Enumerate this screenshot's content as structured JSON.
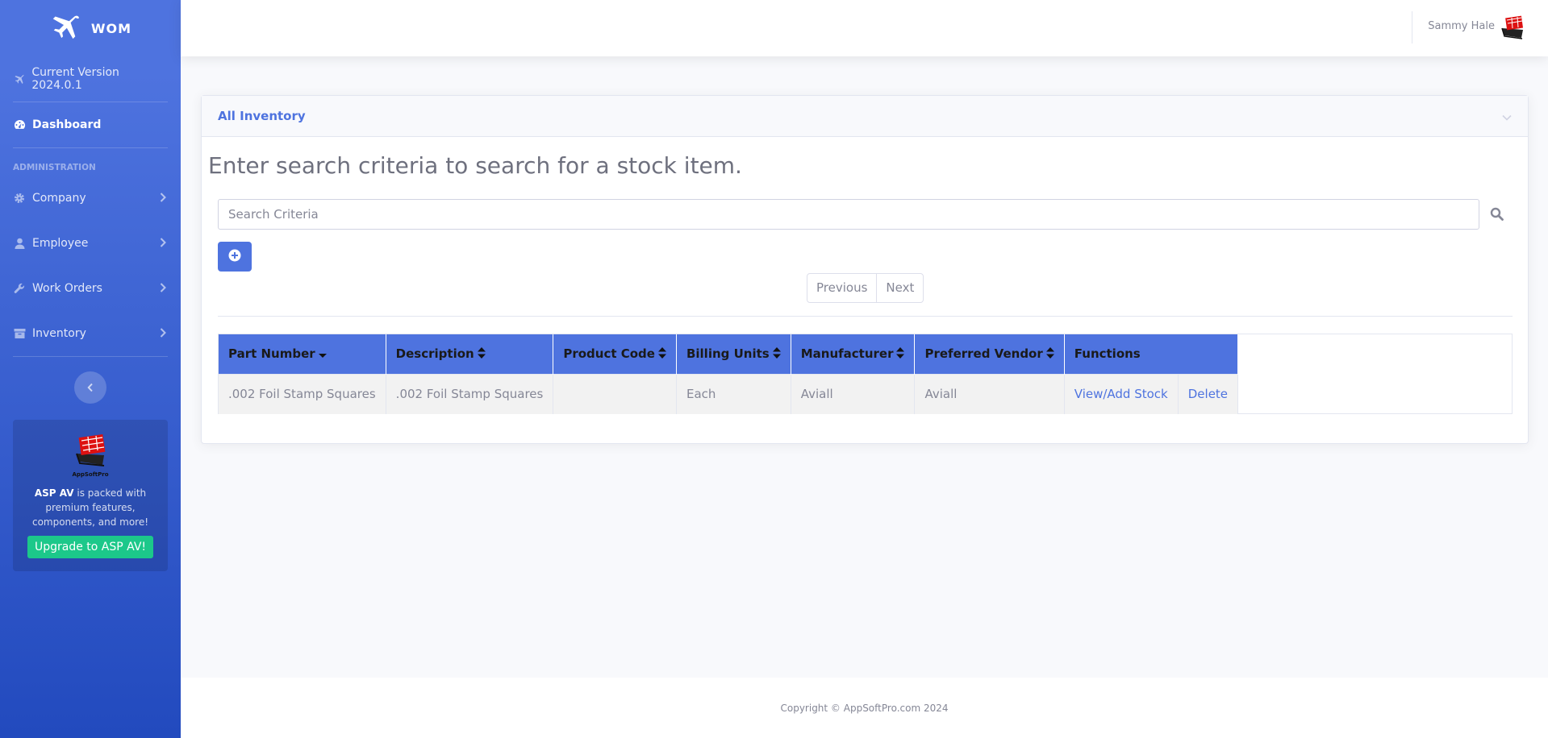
{
  "brand": {
    "name": "WOM",
    "icon": "plane-icon"
  },
  "sidebar": {
    "version_label": "Current Version 2024.0.1",
    "dashboard_label": "Dashboard",
    "section_heading": "ADMINISTRATION",
    "items": [
      {
        "label": "Company",
        "icon": "gear-icon"
      },
      {
        "label": "Employee",
        "icon": "user-icon"
      },
      {
        "label": "Work Orders",
        "icon": "wrench-icon"
      },
      {
        "label": "Inventory",
        "icon": "box-icon"
      }
    ],
    "promo": {
      "logo_caption": "AppSoftPro",
      "text_bold": "ASP AV",
      "text": " is packed with premium features, components, and more!",
      "button_label": "Upgrade to ASP AV!"
    }
  },
  "topbar": {
    "user_name": "Sammy Hale"
  },
  "card": {
    "title": "All Inventory",
    "heading": "Enter search criteria to search for a stock item.",
    "search_placeholder": "Search Criteria",
    "pager": {
      "previous": "Previous",
      "next": "Next"
    },
    "table": {
      "columns": [
        "Part Number",
        "Description",
        "Product Code",
        "Billing Units",
        "Manufacturer",
        "Preferred Vendor",
        "Functions"
      ],
      "rows": [
        {
          "part_number": ".002 Foil Stamp Squares",
          "description": ".002 Foil Stamp Squares",
          "product_code": "",
          "billing_units": "Each",
          "manufacturer": "Aviall",
          "preferred_vendor": "Aviall",
          "action_view": "View/Add Stock",
          "action_delete": "Delete"
        }
      ]
    }
  },
  "footer": {
    "copyright": "Copyright © AppSoftPro.com 2024"
  },
  "colors": {
    "primary": "#4e73df",
    "success": "#1cc88a",
    "sidebar_dark": "#224abe"
  }
}
